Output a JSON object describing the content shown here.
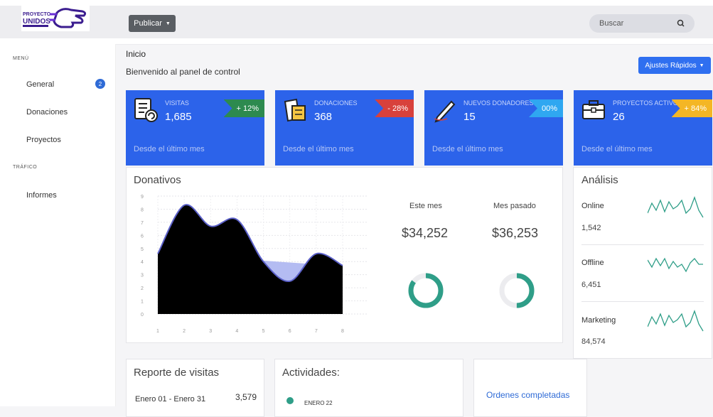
{
  "header": {
    "logo_text_top": "PROYECTO",
    "logo_text_bottom": "UNIDOS",
    "publish_label": "Publicar",
    "search_placeholder": "Buscar"
  },
  "sidebar": {
    "section_menu": "MENÚ",
    "section_traffic": "TRÁFICO",
    "items": [
      {
        "label": "General",
        "badge": "2"
      },
      {
        "label": "Donaciones"
      },
      {
        "label": "Proyectos"
      },
      {
        "label": "Informes"
      }
    ]
  },
  "page": {
    "breadcrumb": "Inicio",
    "welcome": "Bienvenido al panel de control",
    "quick_settings": "Ajustes Rápidos"
  },
  "cards": [
    {
      "label": "VISITAS",
      "value": "1,685",
      "change": "+ 12%",
      "tag_color": "#2d8a4f",
      "footer": "Desde el último mes",
      "icon": "checklist-icon"
    },
    {
      "label": "DONACIONES",
      "value": "368",
      "change": "- 28%",
      "tag_color": "#d8413c",
      "footer": "Desde el último mes",
      "icon": "notes-icon"
    },
    {
      "label": "NUEVOS DONADORES",
      "value": "15",
      "change": "00%",
      "tag_color": "#2fa7f1",
      "footer": "Desde el último mes",
      "icon": "pen-icon"
    },
    {
      "label": "PROYECTOS ACTIVOS",
      "value": "26",
      "change": "+ 84%",
      "tag_color": "#f4b625",
      "footer": "Desde el último mes",
      "icon": "briefcase-icon"
    }
  ],
  "donativos": {
    "title": "Donativos",
    "this_month_label": "Este mes",
    "this_month_value": "$34,252",
    "last_month_label": "Mes pasado",
    "last_month_value": "$36,253",
    "this_month_ratio": 0.85,
    "last_month_ratio": 0.5,
    "accent": "#2f9e88"
  },
  "chart_data": {
    "type": "area",
    "x": [
      1,
      2,
      3,
      4,
      5,
      6,
      7,
      8
    ],
    "series": [
      {
        "values": [
          4.6,
          8.3,
          6.7,
          7.2,
          4.0,
          2.5,
          4.6,
          3.7
        ],
        "color": "#000000",
        "line": "#5b60c8"
      },
      {
        "values": [
          4.6,
          4.47,
          4.33,
          4.2,
          4.07,
          3.93,
          3.8,
          3.7
        ],
        "color": "#b4bcf2"
      }
    ],
    "ylim": [
      0,
      9
    ],
    "yticks": [
      0,
      1,
      2,
      3,
      4,
      5,
      6,
      7,
      8,
      9
    ],
    "xticks": [
      1,
      2,
      3,
      4,
      5,
      6,
      7,
      8
    ],
    "grid": true
  },
  "analysis": {
    "title": "Análisis",
    "items": [
      {
        "label": "Online",
        "value": "1,542"
      },
      {
        "label": "Offline",
        "value": "6,451"
      },
      {
        "label": "Marketing",
        "value": "84,574"
      }
    ],
    "color": "#2f9e88"
  },
  "report": {
    "title": "Reporte de visitas",
    "rows": [
      {
        "range": "Enero 01 - Enero 31",
        "value": "3,579"
      }
    ]
  },
  "activities": {
    "title": "Actividades:",
    "items": [
      {
        "date": "ENERO 22"
      }
    ]
  },
  "orders": {
    "label": "Ordenes completadas"
  }
}
